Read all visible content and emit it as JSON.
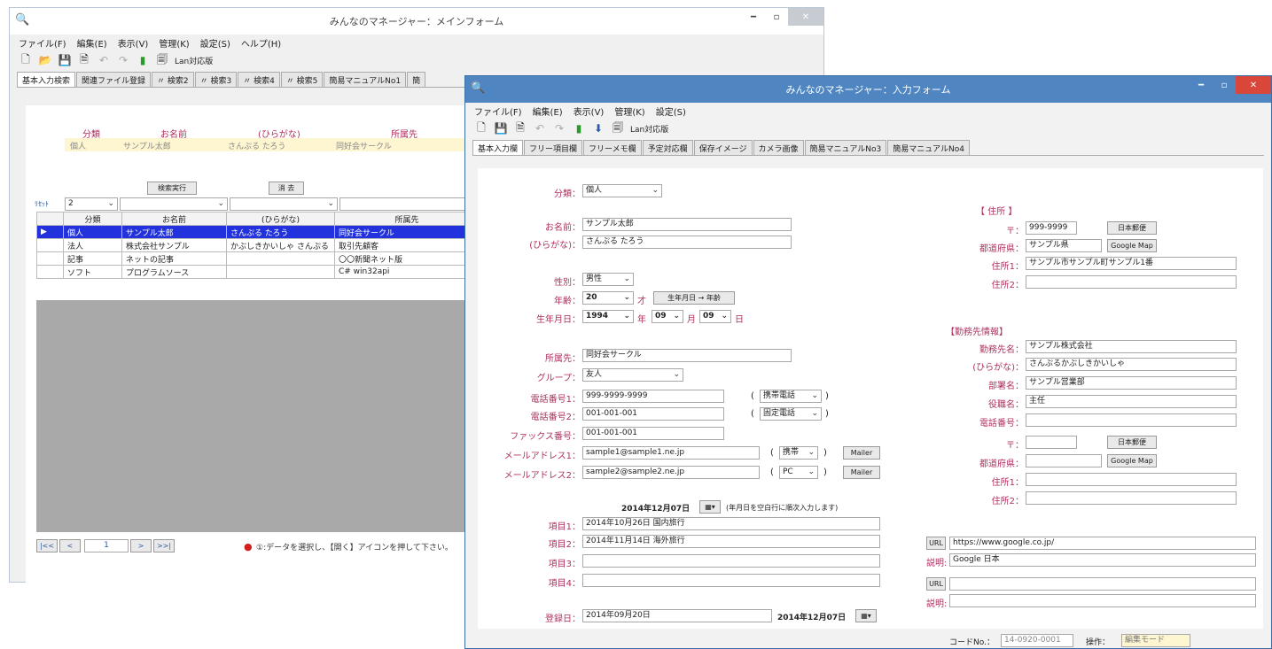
{
  "main": {
    "title": "みんなのマネージャー：メインフォーム",
    "menu": [
      "ファイル(F)",
      "編集(E)",
      "表示(V)",
      "管理(K)",
      "設定(S)",
      "ヘルプ(H)"
    ],
    "lan": "Lan対応版",
    "tabs": [
      "基本入力検索",
      "関連ファイル登録",
      "〃 検索2",
      "〃 検索3",
      "〃 検索4",
      "〃 検索5",
      "簡易マニュアルNo1",
      "簡"
    ],
    "header": {
      "cat": "分類",
      "name": "お名前",
      "kana": "(ひらがな)",
      "org": "所属先"
    },
    "sample": {
      "cat": "個人",
      "name": "サンプル太郎",
      "kana": "さんぷる たろう",
      "org": "同好会サークル"
    },
    "search_btn": "検索実行",
    "clear_btn": "消 去",
    "reset": "ﾘｾｯﾄ",
    "reset_val": "2",
    "cols": [
      "分類",
      "お名前",
      "(ひらがな)",
      "所属先"
    ],
    "rows": [
      [
        "個人",
        "サンプル太郎",
        "さんぷる たろう",
        "同好会サークル"
      ],
      [
        "法人",
        "株式会社サンプル",
        "かぶしきかいしゃ さんぷる",
        "取引先顧客"
      ],
      [
        "記事",
        "ネットの記事",
        "",
        "〇〇新聞ネット版"
      ],
      [
        "ソフト",
        "プログラムソース",
        "",
        "C# win32api"
      ]
    ],
    "nav": [
      "|<<",
      "<",
      "1",
      ">",
      ">>|"
    ],
    "status": "①:データを選択し、【開く】アイコンを押して下さい。"
  },
  "input": {
    "title": "みんなのマネージャー：入力フォーム",
    "menu": [
      "ファイル(F)",
      "編集(E)",
      "表示(V)",
      "管理(K)",
      "設定(S)"
    ],
    "lan": "Lan対応版",
    "tabs": [
      "基本入力欄",
      "フリー項目欄",
      "フリーメモ欄",
      "予定対応欄",
      "保存イメージ",
      "カメラ画像",
      "簡易マニュアルNo3",
      "簡易マニュアルNo4"
    ],
    "l": {
      "cat": "分類：",
      "name": "お名前：",
      "kana": "(ひらがな)：",
      "sex": "性別：",
      "age": "年齢：",
      "birth": "生年月日：",
      "org": "所属先：",
      "group": "グループ：",
      "tel1": "電話番号1：",
      "tel2": "電話番号2：",
      "fax": "ファックス番号：",
      "mail1": "メールアドレス1：",
      "mail2": "メールアドレス2：",
      "item1": "項目1：",
      "item2": "項目2：",
      "item3": "項目3：",
      "item4": "項目4：",
      "reg": "登録日："
    },
    "v": {
      "cat": "個人",
      "name": "サンプル太郎",
      "kana": "さんぷる たろう",
      "sex": "男性",
      "age": "20",
      "age_unit": "才",
      "age_btn": "生年月日 → 年齢",
      "year": "1994",
      "y": "年",
      "month": "09",
      "m": "月",
      "day": "09",
      "d": "日",
      "org": "同好会サークル",
      "group": "友人",
      "tel1": "999-9999-9999",
      "tel1t": "携帯電話",
      "tel2": "001-001-001",
      "tel2t": "固定電話",
      "fax": "001-001-001",
      "mail1": "sample1@sample1.ne.jp",
      "mail1t": "携帯",
      "mail2": "sample2@sample2.ne.jp",
      "mail2t": "PC",
      "mailer": "Mailer",
      "date": "2014年12月07日",
      "date_note": "(年月日を空白行に順次入力します)",
      "item1": "2014年10月26日 国内旅行",
      "item2": "2014年11月14日 海外旅行",
      "reg": "2014年09月20日",
      "reg2": "2014年12月07日"
    },
    "addr": {
      "head": "【 住所 】",
      "zip_l": "〒：",
      "zip": "999-9999",
      "post_btn": "日本郵便",
      "pref_l": "都道府県：",
      "pref": "サンプル県",
      "gmap": "Google Map",
      "a1_l": "住所1：",
      "a1": "サンプル市サンプル町サンプル1番",
      "a2_l": "住所2："
    },
    "work": {
      "head": "【勤務先情報】",
      "co_l": "勤務先名：",
      "co": "サンプル株式会社",
      "kana_l": "(ひらがな)：",
      "kana": "さんぷるかぶしきかいしゃ",
      "dept_l": "部署名：",
      "dept": "サンプル営業部",
      "post_l": "役職名：",
      "post": "主任",
      "tel_l": "電話番号：",
      "zip_l": "〒：",
      "post_btn": "日本郵便",
      "pref_l": "都道府県：",
      "gmap": "Google Map",
      "a1_l": "住所1：",
      "a2_l": "住所2："
    },
    "url": {
      "l": "URL",
      "v": "https://www.google.co.jp/",
      "d_l": "説明:",
      "d": "Google 日本",
      "l2": "URL",
      "d2_l": "説明:"
    },
    "code_l": "コードNo.：",
    "code": "14-0920-0001",
    "op_l": "操作：",
    "op": "編集モード"
  }
}
